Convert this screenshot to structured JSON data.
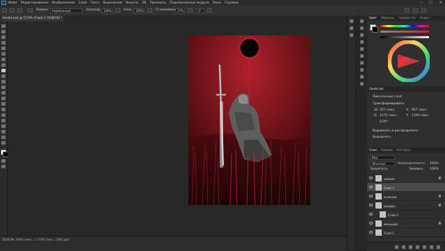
{
  "menubar": {
    "logo": "Ps",
    "items": [
      "Файл",
      "Редактирование",
      "Изображение",
      "Слои",
      "Текст",
      "Выделение",
      "Фильтр",
      "3D",
      "Просмотр",
      "Подключаемые модули",
      "Окно",
      "Справка"
    ]
  },
  "options": {
    "mode_label": "Режим:",
    "mode_value": "Нормальный",
    "opacity_label": "Непрозр.:",
    "opacity_value": "100%",
    "flow_label": "Наж.:",
    "flow_value": "100%",
    "smoothing_label": "Сглаживание:",
    "smoothing_value": "17%",
    "angle_value": "0°"
  },
  "document": {
    "tab_title": "tecket.psd @ 17,6% (Слой 3, RGB/16) *"
  },
  "status": {
    "zoom": "33,61%",
    "doc_size": "2000 пикс. x 2791 пикс. (300 ppi)"
  },
  "color_panel": {
    "tabs": [
      "Цвет",
      "Образцы",
      "Градиенты",
      "Узоры"
    ],
    "accent": "#d81b3a"
  },
  "properties_panel": {
    "tabs": [
      "Свойства"
    ],
    "type_label": "Пиксельный слой",
    "section": "Трансформировать",
    "w_label": "Ш:",
    "w_value": "307 пикс.",
    "x_label": "X:",
    "x_value": "907 пикс.",
    "h_label": "В:",
    "h_value": "1276 пикс.",
    "y_label": "Y:",
    "y_value": "1309 пикс.",
    "angle_value": "0,00°",
    "align_section": "Выровнять и распределить",
    "align_sub": "Выровнять:"
  },
  "layers_panel": {
    "tabs": [
      "Слои",
      "Каналы",
      "Контуры"
    ],
    "filter_label": "Вид",
    "blend_mode": "Обычные",
    "opacity_label": "Непрозрачность:",
    "opacity_value": "100%",
    "lock_label": "Закрепить:",
    "fill_label": "Заливка:",
    "fill_value": "100%",
    "layers": [
      {
        "name": "сияние"
      },
      {
        "name": "Слой 3"
      },
      {
        "name": "колонки"
      },
      {
        "name": "рыцарь"
      },
      {
        "name": "Слой 2"
      },
      {
        "name": "меньшие"
      },
      {
        "name": "Слой 1"
      }
    ]
  }
}
